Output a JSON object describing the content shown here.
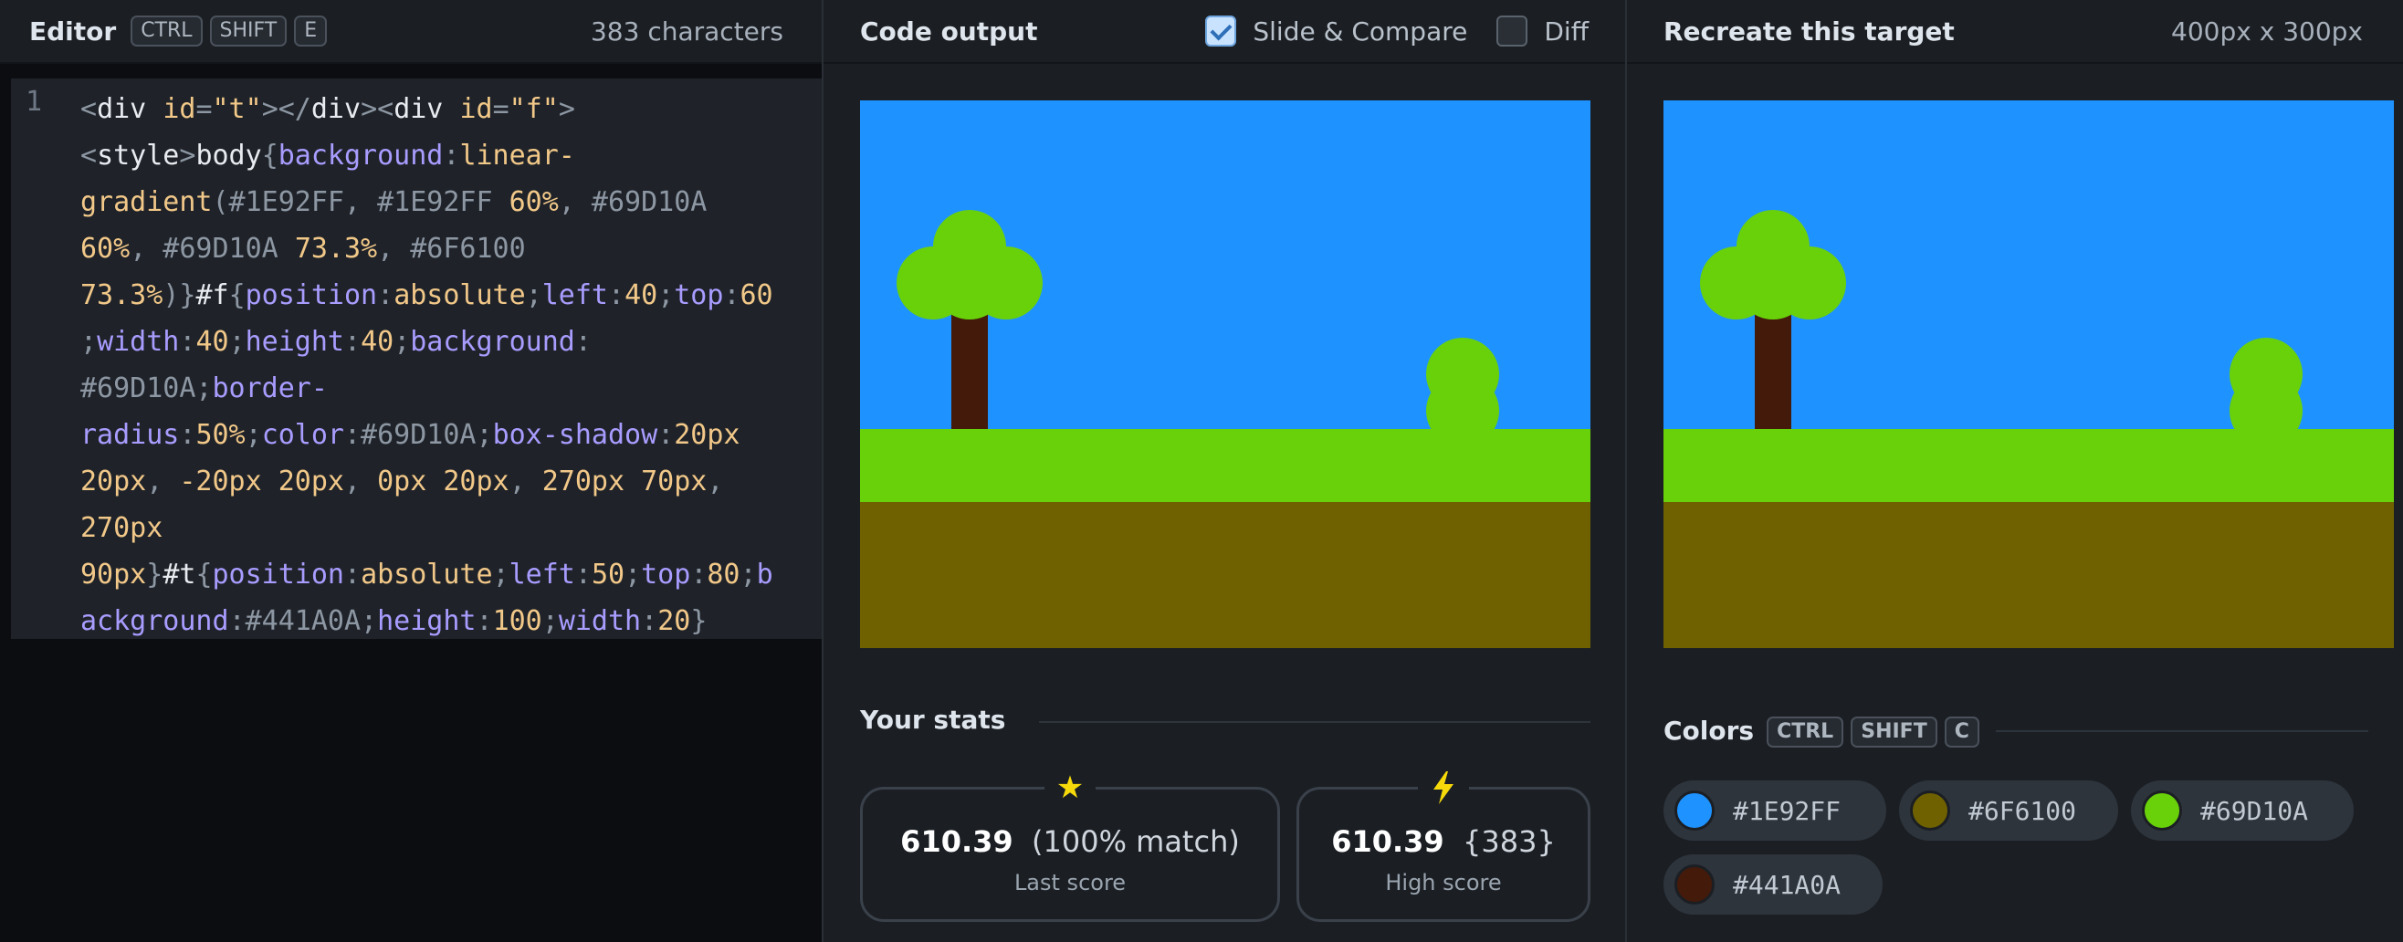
{
  "editor": {
    "title": "Editor",
    "shortcut": [
      "CTRL",
      "SHIFT",
      "E"
    ],
    "char_count": "383 characters",
    "line_number": "1",
    "code_lines": [
      [
        [
          "t-gray",
          "<"
        ],
        [
          "t-white",
          "div "
        ],
        [
          "t-orange",
          "id"
        ],
        [
          "t-gray",
          "="
        ],
        [
          "t-orange",
          "\"t\""
        ],
        [
          "t-gray",
          "></"
        ],
        [
          "t-white",
          "div"
        ],
        [
          "t-gray",
          "><"
        ],
        [
          "t-white",
          "div "
        ],
        [
          "t-orange",
          "id"
        ],
        [
          "t-gray",
          "="
        ],
        [
          "t-orange",
          "\"f\""
        ],
        [
          "t-gray",
          ">"
        ]
      ],
      [
        [
          "t-gray",
          "<"
        ],
        [
          "t-white",
          "style"
        ],
        [
          "t-gray",
          ">"
        ],
        [
          "t-white",
          "body"
        ],
        [
          "t-gray",
          "{"
        ],
        [
          "t-purple",
          "background"
        ],
        [
          "t-gray",
          ":"
        ],
        [
          "t-orange",
          "linear-"
        ]
      ],
      [
        [
          "t-orange",
          "gradient"
        ],
        [
          "t-gray",
          "(#1E92FF, #1E92FF "
        ],
        [
          "t-orange",
          "60%"
        ],
        [
          "t-gray",
          ", #69D10A"
        ]
      ],
      [
        [
          "t-orange",
          "60%"
        ],
        [
          "t-gray",
          ", #69D10A "
        ],
        [
          "t-orange",
          "73.3%"
        ],
        [
          "t-gray",
          ", #6F6100"
        ]
      ],
      [
        [
          "t-orange",
          "73.3%"
        ],
        [
          "t-gray",
          ")}"
        ],
        [
          "t-white",
          "#f"
        ],
        [
          "t-gray",
          "{"
        ],
        [
          "t-purple",
          "position"
        ],
        [
          "t-gray",
          ":"
        ],
        [
          "t-orange",
          "absolute"
        ],
        [
          "t-gray",
          ";"
        ],
        [
          "t-purple",
          "left"
        ],
        [
          "t-gray",
          ":"
        ],
        [
          "t-orange",
          "40"
        ],
        [
          "t-gray",
          ";"
        ],
        [
          "t-purple",
          "top"
        ],
        [
          "t-gray",
          ":"
        ],
        [
          "t-orange",
          "60"
        ]
      ],
      [
        [
          "t-gray",
          ";"
        ],
        [
          "t-purple",
          "width"
        ],
        [
          "t-gray",
          ":"
        ],
        [
          "t-orange",
          "40"
        ],
        [
          "t-gray",
          ";"
        ],
        [
          "t-purple",
          "height"
        ],
        [
          "t-gray",
          ":"
        ],
        [
          "t-orange",
          "40"
        ],
        [
          "t-gray",
          ";"
        ],
        [
          "t-purple",
          "background"
        ],
        [
          "t-gray",
          ":"
        ]
      ],
      [
        [
          "t-gray",
          "#69D10A;"
        ],
        [
          "t-purple",
          "border-"
        ]
      ],
      [
        [
          "t-purple",
          "radius"
        ],
        [
          "t-gray",
          ":"
        ],
        [
          "t-orange",
          "50%"
        ],
        [
          "t-gray",
          ";"
        ],
        [
          "t-purple",
          "color"
        ],
        [
          "t-gray",
          ":#69D10A;"
        ],
        [
          "t-purple",
          "box-shadow"
        ],
        [
          "t-gray",
          ":"
        ],
        [
          "t-orange",
          "20px"
        ]
      ],
      [
        [
          "t-orange",
          "20px"
        ],
        [
          "t-gray",
          ", "
        ],
        [
          "t-orange",
          "-20px 20px"
        ],
        [
          "t-gray",
          ", "
        ],
        [
          "t-orange",
          "0px 20px"
        ],
        [
          "t-gray",
          ", "
        ],
        [
          "t-orange",
          "270px 70px"
        ],
        [
          "t-gray",
          ","
        ]
      ],
      [
        [
          "t-orange",
          "270px"
        ]
      ],
      [
        [
          "t-orange",
          "90px"
        ],
        [
          "t-gray",
          "}"
        ],
        [
          "t-white",
          "#t"
        ],
        [
          "t-gray",
          "{"
        ],
        [
          "t-purple",
          "position"
        ],
        [
          "t-gray",
          ":"
        ],
        [
          "t-orange",
          "absolute"
        ],
        [
          "t-gray",
          ";"
        ],
        [
          "t-purple",
          "left"
        ],
        [
          "t-gray",
          ":"
        ],
        [
          "t-orange",
          "50"
        ],
        [
          "t-gray",
          ";"
        ],
        [
          "t-purple",
          "top"
        ],
        [
          "t-gray",
          ":"
        ],
        [
          "t-orange",
          "80"
        ],
        [
          "t-gray",
          ";"
        ],
        [
          "t-purple",
          "b"
        ]
      ],
      [
        [
          "t-purple",
          "ackground"
        ],
        [
          "t-gray",
          ":#441A0A;"
        ],
        [
          "t-purple",
          "height"
        ],
        [
          "t-gray",
          ":"
        ],
        [
          "t-orange",
          "100"
        ],
        [
          "t-gray",
          ";"
        ],
        [
          "t-purple",
          "width"
        ],
        [
          "t-gray",
          ":"
        ],
        [
          "t-orange",
          "20"
        ],
        [
          "t-gray",
          "}"
        ]
      ]
    ]
  },
  "output": {
    "title": "Code output",
    "slide_compare_label": "Slide & Compare",
    "slide_compare_checked": true,
    "diff_label": "Diff",
    "diff_checked": false
  },
  "stats": {
    "title": "Your stats",
    "last_score_value": "610.39",
    "last_score_detail": "(100% match)",
    "last_score_label": "Last score",
    "last_score_icon": "star-icon",
    "high_score_value": "610.39",
    "high_score_detail": "{383}",
    "high_score_label": "High score",
    "high_score_icon": "lightning-icon"
  },
  "target": {
    "title": "Recreate this target",
    "size": "400px x 300px"
  },
  "colors": {
    "title": "Colors",
    "shortcut": [
      "CTRL",
      "SHIFT",
      "C"
    ],
    "swatches": [
      "#1E92FF",
      "#6F6100",
      "#69D10A",
      "#441A0A"
    ]
  },
  "scene_colors": {
    "sky": "#1E92FF",
    "grass": "#69D10A",
    "dirt": "#6F6100",
    "trunk": "#441A0A",
    "leaf": "#69D10A"
  }
}
